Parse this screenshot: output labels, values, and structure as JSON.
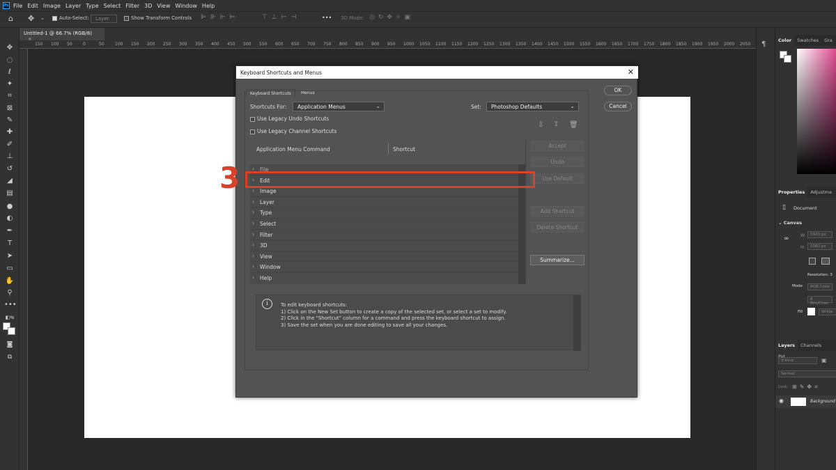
{
  "menubar": {
    "app_icon": "Ps",
    "items": [
      "File",
      "Edit",
      "Image",
      "Layer",
      "Type",
      "Select",
      "Filter",
      "3D",
      "View",
      "Window",
      "Help"
    ]
  },
  "options_bar": {
    "auto_select_label": "Auto-Select:",
    "auto_select_target": "Layer",
    "show_transform_label": "Show Transform Controls",
    "mode_3d_label": "3D Mode:",
    "more": "•••"
  },
  "document_tab": {
    "label": "Untitled-1 @ 66.7% (RGB/8)",
    "close": "×"
  },
  "ruler_ticks": [
    "150",
    "100",
    "50",
    "0",
    "50",
    "100",
    "150",
    "200",
    "250",
    "300",
    "350",
    "400",
    "450",
    "500",
    "550",
    "600",
    "650",
    "700",
    "750",
    "800",
    "850",
    "900",
    "950",
    "1000",
    "1050",
    "1100",
    "1150",
    "1200",
    "1250",
    "1300",
    "1350",
    "1400",
    "1450",
    "1500",
    "1550",
    "1600",
    "1650",
    "1700",
    "1750",
    "1800",
    "1850",
    "1900",
    "1950",
    "2000",
    "2050"
  ],
  "right_panels": {
    "color_tabs": [
      "Color",
      "Swatches",
      "Gra"
    ],
    "properties_tabs": [
      "Properties",
      "Adjustme"
    ],
    "document_label": "Document",
    "canvas_label": "Canvas",
    "w_label": "W",
    "w_value": "1920 px",
    "h_label": "H",
    "h_value": "1080 px",
    "resolution_label": "Resolution: 3",
    "mode_label": "Mode",
    "mode_value": "RGB Color",
    "bits_value": "8 Bits/Chan",
    "fill_label": "Fill",
    "fill_value": "White",
    "layers_tabs": [
      "Layers",
      "Channels",
      "Pat"
    ],
    "kind_label": "Kind",
    "blend_label": "Normal",
    "lock_label": "Lock:",
    "layer_name": "Background"
  },
  "dialog": {
    "title": "Keyboard Shortcuts and Menus",
    "close": "✕",
    "tabs": [
      "Keyboard Shortcuts",
      "Menus"
    ],
    "shortcuts_for_label": "Shortcuts For:",
    "shortcuts_for_value": "Application Menus",
    "set_label": "Set:",
    "set_value": "Photoshop Defaults",
    "legacy_undo": "Use Legacy Undo Shortcuts",
    "legacy_channel": "Use Legacy Channel Shortcuts",
    "ok": "OK",
    "cancel": "Cancel",
    "col_command": "Application Menu Command",
    "col_shortcut": "Shortcut",
    "rows": [
      "File",
      "Edit",
      "Image",
      "Layer",
      "Type",
      "Select",
      "Filter",
      "3D",
      "View",
      "Window",
      "Help"
    ],
    "side_buttons": {
      "accept": "Accept",
      "undo": "Undo",
      "use_default": "Use Default",
      "add_shortcut": "Add Shortcut",
      "delete_shortcut": "Delete Shortcut",
      "summarize": "Summarize..."
    },
    "info_text": "To edit keyboard shortcuts:\n1) Click on the New Set button to create a copy of the selected set, or select a set to modify.\n2) Click in the \"Shortcut\" column for a command and press the keyboard shortcut to assign.\n3) Save the set when you are done editing to save all your changes."
  },
  "annotation": {
    "step_number": "3",
    "highlight_color": "#d8422b"
  }
}
